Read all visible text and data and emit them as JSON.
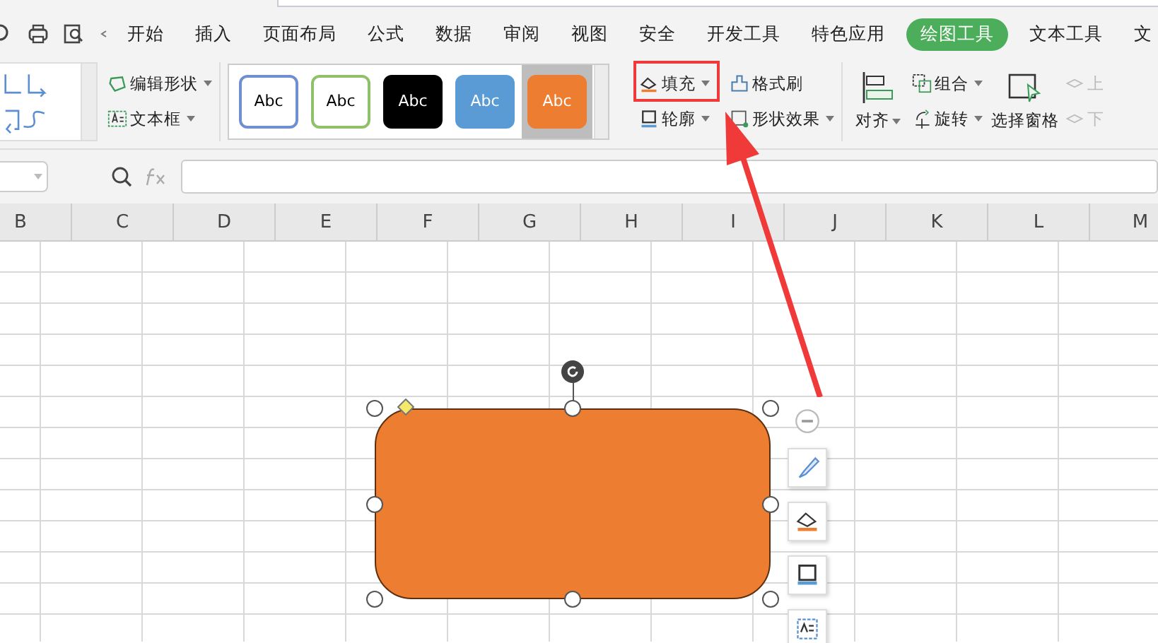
{
  "tabs": [
    {
      "label": "开始",
      "selected": false
    },
    {
      "label": "插入",
      "selected": false
    },
    {
      "label": "页面布局",
      "selected": false
    },
    {
      "label": "公式",
      "selected": false
    },
    {
      "label": "数据",
      "selected": false
    },
    {
      "label": "审阅",
      "selected": false
    },
    {
      "label": "视图",
      "selected": false
    },
    {
      "label": "安全",
      "selected": false
    },
    {
      "label": "开发工具",
      "selected": false
    },
    {
      "label": "特色应用",
      "selected": false
    },
    {
      "label": "绘图工具",
      "selected": true
    },
    {
      "label": "文本工具",
      "selected": false
    },
    {
      "label": "文",
      "selected": false
    }
  ],
  "ribbon": {
    "edit_shape": "编辑形状",
    "text_box": "文本框",
    "style_presets": [
      {
        "label": "Abc",
        "kind": "outline",
        "color": "#6f8fd0",
        "selected": false
      },
      {
        "label": "Abc",
        "kind": "outline",
        "color": "#8fc06a",
        "selected": false
      },
      {
        "label": "Abc",
        "kind": "filled",
        "color": "#000000",
        "selected": false
      },
      {
        "label": "Abc",
        "kind": "filled",
        "color": "#5b9bd5",
        "selected": false
      },
      {
        "label": "Abc",
        "kind": "filled",
        "color": "#ed7d31",
        "selected": true
      }
    ],
    "fill": "填充",
    "outline": "轮廓",
    "format_painter": "格式刷",
    "shape_effects": "形状效果",
    "align": "对齐",
    "group": "组合",
    "rotate": "旋转",
    "selection_pane": "选择窗格",
    "bring_forward": {
      "label": "上",
      "disabled": true
    },
    "send_backward": {
      "label": "下",
      "disabled": true
    }
  },
  "columns": [
    "B",
    "C",
    "D",
    "E",
    "F",
    "G",
    "H",
    "I",
    "J",
    "K",
    "L",
    "M"
  ]
}
